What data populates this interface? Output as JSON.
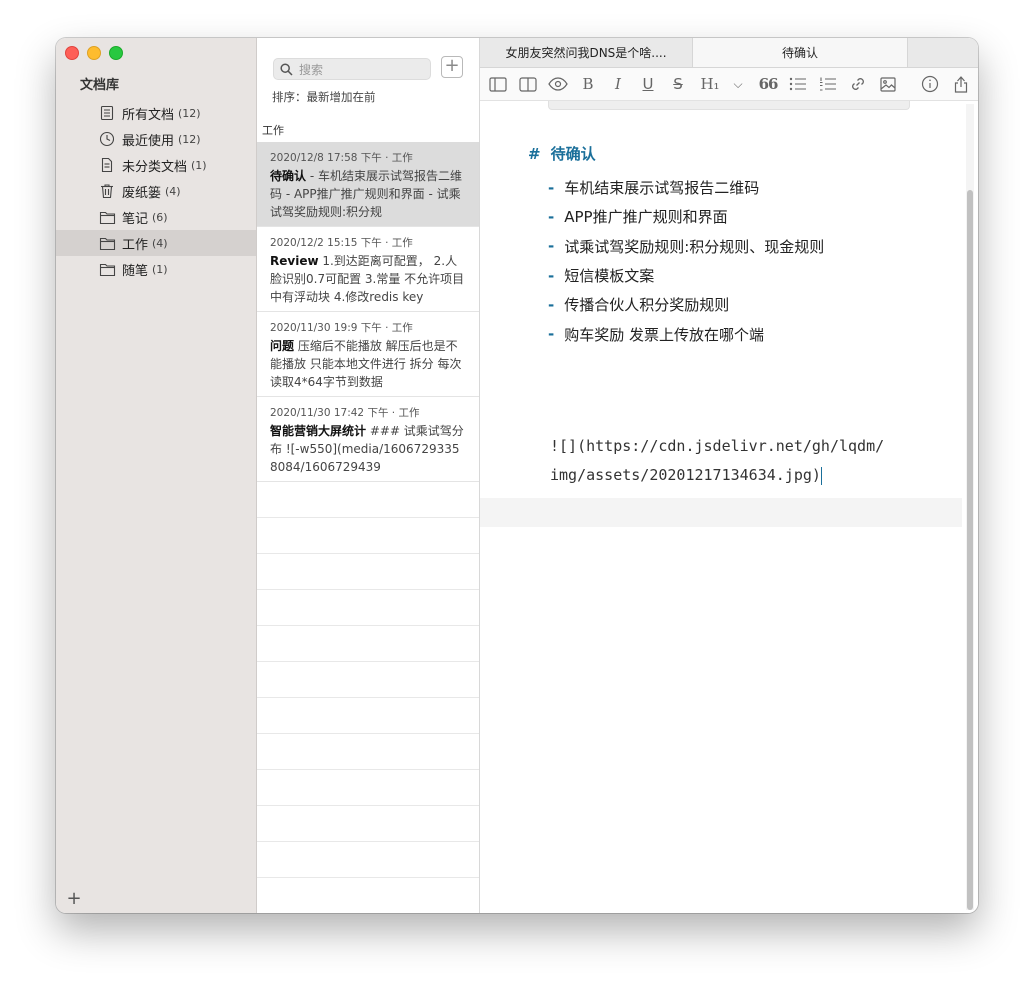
{
  "sidebar": {
    "title": "文档库",
    "items": [
      {
        "label": "所有文档",
        "count": "(12)",
        "icon": "documents-stack-icon"
      },
      {
        "label": "最近使用",
        "count": "(12)",
        "icon": "clock-icon"
      },
      {
        "label": "未分类文档",
        "count": "(1)",
        "icon": "document-icon"
      },
      {
        "label": "废纸篓",
        "count": "(4)",
        "icon": "trash-icon"
      },
      {
        "label": "笔记",
        "count": "(6)",
        "icon": "folder-icon"
      },
      {
        "label": "工作",
        "count": "(4)",
        "icon": "folder-icon",
        "active": true
      },
      {
        "label": "随笔",
        "count": "(1)",
        "icon": "folder-icon"
      }
    ],
    "add_label": "+"
  },
  "notelist": {
    "search_placeholder": "搜索",
    "add_label": "+",
    "sort_text": "排序：最新增加在前",
    "group_header": "工作",
    "notes": [
      {
        "meta": "2020/12/8 17:58 下午  · 工作",
        "title": "待确认",
        "body": " - 车机结束展示试驾报告二维码 - APP推广推广规则和界面 - 试乘试驾奖励规则:积分规"
      },
      {
        "meta": "2020/12/2 15:15 下午  · 工作",
        "title": "Review",
        "body": " 1.到达距离可配置， 2.人脸识别0.7可配置 3.常量  不允许项目中有浮动块 4.修改redis key"
      },
      {
        "meta": "2020/11/30 19:9 下午  · 工作",
        "title": "问题",
        "body": " 压缩后不能播放 解压后也是不能播放 只能本地文件进行  拆分 每次读取4*64字节到数据"
      },
      {
        "meta": "2020/11/30 17:42 下午  · 工作",
        "title": "智能营销大屏统计",
        "body": " ### 试乘试驾分布 ![-w550](media/16067293358084/1606729439"
      }
    ]
  },
  "editor": {
    "tabs": [
      "女朋友突然问我DNS是个啥....",
      "待确认"
    ],
    "toolbar_labels": {
      "bold": "B",
      "italic": "I",
      "underline": "U",
      "strike": "S",
      "heading": "H₁",
      "chevron": "⌵",
      "quote": "66"
    },
    "heading_hash": "#",
    "heading": "待确认",
    "list_dash": "-",
    "items": [
      "车机结束展示试驾报告二维码",
      "APP推广推广规则和界面",
      "试乘试驾奖励规则:积分规则、现金规则",
      "短信模板文案",
      "传播合伙人积分奖励规则",
      "购车奖励  发票上传放在哪个端"
    ],
    "code_line1": "![](https://cdn.jsdelivr.net/gh/lqdm/",
    "code_line2": "img/assets/20201217134634.jpg)"
  }
}
